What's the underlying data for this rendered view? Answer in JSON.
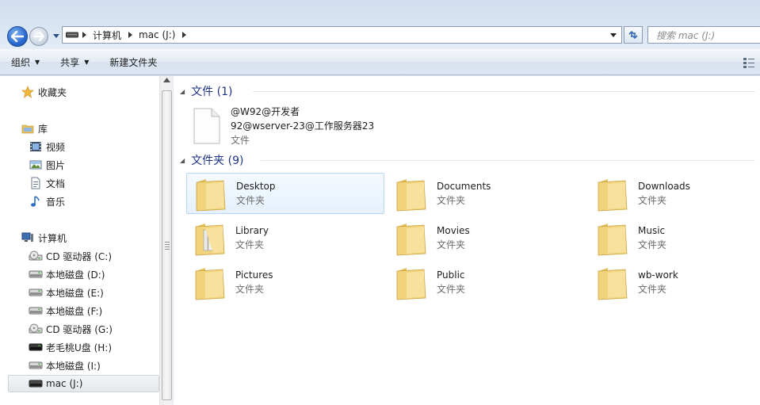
{
  "address_bar": {
    "crumbs": [
      "计算机",
      "mac (J:)"
    ],
    "search_placeholder": "搜索 mac (J:)"
  },
  "toolbar": {
    "organize": "组织",
    "share": "共享",
    "new_folder": "新建文件夹"
  },
  "nav": {
    "favorites": "收藏夹",
    "libraries": "库",
    "library_items": [
      "视频",
      "图片",
      "文档",
      "音乐"
    ],
    "computer": "计算机",
    "drives": [
      {
        "label": "CD 驱动器 (C:)",
        "icon": "cd-drive-icon"
      },
      {
        "label": "本地磁盘 (D:)",
        "icon": "hard-drive-icon"
      },
      {
        "label": "本地磁盘 (E:)",
        "icon": "hard-drive-icon"
      },
      {
        "label": "本地磁盘 (F:)",
        "icon": "hard-drive-icon"
      },
      {
        "label": "CD 驱动器 (G:)",
        "icon": "cd-drive-icon"
      },
      {
        "label": "老毛桃U盘 (H:)",
        "icon": "usb-drive-icon"
      },
      {
        "label": "本地磁盘 (I:)",
        "icon": "hard-drive-icon"
      },
      {
        "label": "mac (J:)",
        "icon": "network-drive-icon"
      }
    ],
    "selected": "mac (J:)"
  },
  "content": {
    "files_group": "文件 (1)",
    "file": {
      "line1": "@W92@开发者",
      "line2": "92@wserver-23@工作服务器23",
      "type": "文件"
    },
    "folders_group": "文件夹 (9)",
    "folder_type": "文件夹",
    "folders": [
      "Desktop",
      "Documents",
      "Downloads",
      "Library",
      "Movies",
      "Music",
      "Pictures",
      "Public",
      "wb-work"
    ]
  },
  "colors": {
    "group_header": "#1e3287",
    "folder_yellow": "#f4d77a",
    "hover_border": "#b9d7fc"
  }
}
